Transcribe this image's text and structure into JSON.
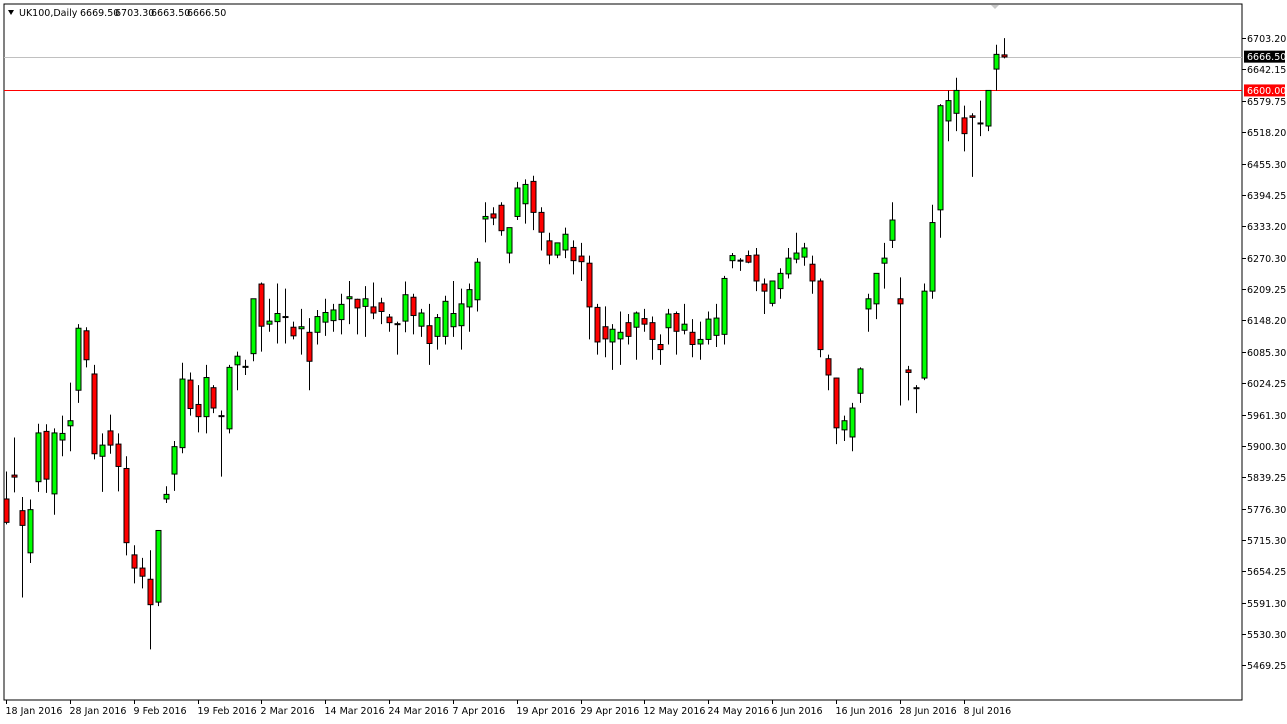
{
  "header": {
    "symbol": "UK100,Daily",
    "open": "6669.50",
    "high": "6703.30",
    "low": "6663.50",
    "close": "6666.50"
  },
  "chart_data": {
    "type": "candlestick",
    "symbol": "UK100",
    "timeframe": "Daily",
    "x_labels": [
      "18 Jan 2016",
      "28 Jan 2016",
      "9 Feb 2016",
      "19 Feb 2016",
      "2 Mar 2016",
      "14 Mar 2016",
      "24 Mar 2016",
      "7 Apr 2016",
      "19 Apr 2016",
      "29 Apr 2016",
      "12 May 2016",
      "24 May 2016",
      "6 Jun 2016",
      "16 Jun 2016",
      "28 Jun 2016",
      "8 Jul 2016"
    ],
    "y_ticks": [
      "6703.20",
      "6642.15",
      "6579.75",
      "6518.20",
      "6455.30",
      "6394.25",
      "6333.20",
      "6270.30",
      "6209.25",
      "6148.20",
      "6085.30",
      "6024.25",
      "5961.30",
      "5900.30",
      "5839.25",
      "5776.30",
      "5715.30",
      "5654.25",
      "5591.30",
      "5530.30",
      "5469.25"
    ],
    "ylim": [
      5458,
      6730
    ],
    "current_price": {
      "value": 6666.5,
      "label": "6666.50"
    },
    "levels": [
      {
        "value": 6600.0,
        "label": "6600.00",
        "color": "#ff0000"
      }
    ],
    "colors": {
      "bull": "#00ff00",
      "bear": "#ff0000",
      "outline": "#000000",
      "axis": "#000000",
      "current_line": "#c0c0c0"
    },
    "candles": [
      {
        "o": 5796,
        "h": 5850,
        "l": 5746,
        "c": 5750
      },
      {
        "o": 5843,
        "h": 5917,
        "l": 5809,
        "c": 5839
      },
      {
        "o": 5773,
        "h": 5800,
        "l": 5602,
        "c": 5744
      },
      {
        "o": 5690,
        "h": 5795,
        "l": 5670,
        "c": 5775
      },
      {
        "o": 5830,
        "h": 5944,
        "l": 5810,
        "c": 5926
      },
      {
        "o": 5929,
        "h": 5943,
        "l": 5808,
        "c": 5835
      },
      {
        "o": 5806,
        "h": 5935,
        "l": 5765,
        "c": 5926
      },
      {
        "o": 5912,
        "h": 5960,
        "l": 5880,
        "c": 5925
      },
      {
        "o": 5940,
        "h": 6025,
        "l": 5890,
        "c": 5950
      },
      {
        "o": 6010,
        "h": 6140,
        "l": 5985,
        "c": 6132
      },
      {
        "o": 6127,
        "h": 6134,
        "l": 6055,
        "c": 6070
      },
      {
        "o": 6042,
        "h": 6060,
        "l": 5874,
        "c": 5885
      },
      {
        "o": 5880,
        "h": 5925,
        "l": 5810,
        "c": 5902
      },
      {
        "o": 5930,
        "h": 5962,
        "l": 5885,
        "c": 5902
      },
      {
        "o": 5904,
        "h": 5925,
        "l": 5811,
        "c": 5860
      },
      {
        "o": 5856,
        "h": 5880,
        "l": 5685,
        "c": 5710
      },
      {
        "o": 5686,
        "h": 5705,
        "l": 5630,
        "c": 5660
      },
      {
        "o": 5660,
        "h": 5680,
        "l": 5620,
        "c": 5644
      },
      {
        "o": 5638,
        "h": 5695,
        "l": 5500,
        "c": 5588
      },
      {
        "o": 5593,
        "h": 5735,
        "l": 5585,
        "c": 5734
      },
      {
        "o": 5796,
        "h": 5821,
        "l": 5788,
        "c": 5805
      },
      {
        "o": 5845,
        "h": 5910,
        "l": 5812,
        "c": 5899
      },
      {
        "o": 5897,
        "h": 6064,
        "l": 5886,
        "c": 6032
      },
      {
        "o": 6030,
        "h": 6045,
        "l": 5960,
        "c": 5974
      },
      {
        "o": 5982,
        "h": 6020,
        "l": 5927,
        "c": 5958
      },
      {
        "o": 5958,
        "h": 6060,
        "l": 5925,
        "c": 6035
      },
      {
        "o": 6015,
        "h": 6020,
        "l": 5965,
        "c": 5975
      },
      {
        "o": 5959,
        "h": 5970,
        "l": 5840,
        "c": 5960
      },
      {
        "o": 5934,
        "h": 6060,
        "l": 5925,
        "c": 6055
      },
      {
        "o": 6060,
        "h": 6086,
        "l": 6010,
        "c": 6077
      },
      {
        "o": 6055,
        "h": 6070,
        "l": 6040,
        "c": 6057
      },
      {
        "o": 6082,
        "h": 6140,
        "l": 6067,
        "c": 6190
      },
      {
        "o": 6219,
        "h": 6222,
        "l": 6086,
        "c": 6136
      },
      {
        "o": 6140,
        "h": 6190,
        "l": 6125,
        "c": 6146
      },
      {
        "o": 6145,
        "h": 6220,
        "l": 6102,
        "c": 6161
      },
      {
        "o": 6154,
        "h": 6210,
        "l": 6102,
        "c": 6155
      },
      {
        "o": 6134,
        "h": 6145,
        "l": 6110,
        "c": 6117
      },
      {
        "o": 6131,
        "h": 6170,
        "l": 6080,
        "c": 6135
      },
      {
        "o": 6124,
        "h": 6152,
        "l": 6010,
        "c": 6067
      },
      {
        "o": 6124,
        "h": 6168,
        "l": 6100,
        "c": 6155
      },
      {
        "o": 6144,
        "h": 6190,
        "l": 6117,
        "c": 6163
      },
      {
        "o": 6147,
        "h": 6180,
        "l": 6125,
        "c": 6168
      },
      {
        "o": 6149,
        "h": 6200,
        "l": 6120,
        "c": 6179
      },
      {
        "o": 6190,
        "h": 6225,
        "l": 6140,
        "c": 6194
      },
      {
        "o": 6189,
        "h": 6190,
        "l": 6120,
        "c": 6172
      },
      {
        "o": 6175,
        "h": 6215,
        "l": 6115,
        "c": 6190
      },
      {
        "o": 6174,
        "h": 6222,
        "l": 6150,
        "c": 6162
      },
      {
        "o": 6182,
        "h": 6192,
        "l": 6140,
        "c": 6165
      },
      {
        "o": 6154,
        "h": 6160,
        "l": 6125,
        "c": 6143
      },
      {
        "o": 6141,
        "h": 6145,
        "l": 6080,
        "c": 6140
      },
      {
        "o": 6146,
        "h": 6224,
        "l": 6124,
        "c": 6198
      },
      {
        "o": 6193,
        "h": 6200,
        "l": 6120,
        "c": 6157
      },
      {
        "o": 6136,
        "h": 6170,
        "l": 6115,
        "c": 6162
      },
      {
        "o": 6137,
        "h": 6180,
        "l": 6060,
        "c": 6102
      },
      {
        "o": 6116,
        "h": 6160,
        "l": 6090,
        "c": 6153
      },
      {
        "o": 6116,
        "h": 6196,
        "l": 6100,
        "c": 6185
      },
      {
        "o": 6135,
        "h": 6225,
        "l": 6115,
        "c": 6161
      },
      {
        "o": 6137,
        "h": 6210,
        "l": 6090,
        "c": 6180
      },
      {
        "o": 6174,
        "h": 6220,
        "l": 6125,
        "c": 6208
      },
      {
        "o": 6188,
        "h": 6270,
        "l": 6165,
        "c": 6262
      },
      {
        "o": 6347,
        "h": 6380,
        "l": 6301,
        "c": 6352
      },
      {
        "o": 6357,
        "h": 6370,
        "l": 6335,
        "c": 6349
      },
      {
        "o": 6374,
        "h": 6380,
        "l": 6314,
        "c": 6324
      },
      {
        "o": 6280,
        "h": 6310,
        "l": 6260,
        "c": 6330
      },
      {
        "o": 6352,
        "h": 6420,
        "l": 6345,
        "c": 6408
      },
      {
        "o": 6377,
        "h": 6425,
        "l": 6338,
        "c": 6415
      },
      {
        "o": 6421,
        "h": 6432,
        "l": 6325,
        "c": 6360
      },
      {
        "o": 6360,
        "h": 6370,
        "l": 6285,
        "c": 6321
      },
      {
        "o": 6304,
        "h": 6320,
        "l": 6258,
        "c": 6276
      },
      {
        "o": 6276,
        "h": 6300,
        "l": 6270,
        "c": 6300
      },
      {
        "o": 6286,
        "h": 6330,
        "l": 6270,
        "c": 6317
      },
      {
        "o": 6291,
        "h": 6305,
        "l": 6238,
        "c": 6265
      },
      {
        "o": 6274,
        "h": 6300,
        "l": 6225,
        "c": 6263
      },
      {
        "o": 6260,
        "h": 6275,
        "l": 6110,
        "c": 6174
      },
      {
        "o": 6173,
        "h": 6180,
        "l": 6080,
        "c": 6105
      },
      {
        "o": 6135,
        "h": 6175,
        "l": 6075,
        "c": 6111
      },
      {
        "o": 6105,
        "h": 6140,
        "l": 6050,
        "c": 6130
      },
      {
        "o": 6111,
        "h": 6165,
        "l": 6060,
        "c": 6124
      },
      {
        "o": 6143,
        "h": 6160,
        "l": 6100,
        "c": 6116
      },
      {
        "o": 6134,
        "h": 6165,
        "l": 6070,
        "c": 6162
      },
      {
        "o": 6151,
        "h": 6170,
        "l": 6125,
        "c": 6140
      },
      {
        "o": 6143,
        "h": 6155,
        "l": 6070,
        "c": 6110
      },
      {
        "o": 6100,
        "h": 6120,
        "l": 6060,
        "c": 6090
      },
      {
        "o": 6133,
        "h": 6170,
        "l": 6100,
        "c": 6160
      },
      {
        "o": 6161,
        "h": 6165,
        "l": 6080,
        "c": 6126
      },
      {
        "o": 6128,
        "h": 6180,
        "l": 6120,
        "c": 6140
      },
      {
        "o": 6124,
        "h": 6150,
        "l": 6075,
        "c": 6100
      },
      {
        "o": 6101,
        "h": 6145,
        "l": 6070,
        "c": 6110
      },
      {
        "o": 6110,
        "h": 6165,
        "l": 6100,
        "c": 6150
      },
      {
        "o": 6118,
        "h": 6180,
        "l": 6095,
        "c": 6152
      },
      {
        "o": 6120,
        "h": 6235,
        "l": 6100,
        "c": 6230
      },
      {
        "o": 6265,
        "h": 6280,
        "l": 6250,
        "c": 6275
      },
      {
        "o": 6266,
        "h": 6270,
        "l": 6245,
        "c": 6265
      },
      {
        "o": 6275,
        "h": 6285,
        "l": 6260,
        "c": 6262
      },
      {
        "o": 6276,
        "h": 6290,
        "l": 6205,
        "c": 6225
      },
      {
        "o": 6219,
        "h": 6230,
        "l": 6160,
        "c": 6205
      },
      {
        "o": 6181,
        "h": 6222,
        "l": 6175,
        "c": 6225
      },
      {
        "o": 6210,
        "h": 6250,
        "l": 6190,
        "c": 6240
      },
      {
        "o": 6239,
        "h": 6290,
        "l": 6230,
        "c": 6270
      },
      {
        "o": 6268,
        "h": 6320,
        "l": 6260,
        "c": 6280
      },
      {
        "o": 6272,
        "h": 6300,
        "l": 6255,
        "c": 6290
      },
      {
        "o": 6258,
        "h": 6275,
        "l": 6200,
        "c": 6225
      },
      {
        "o": 6225,
        "h": 6230,
        "l": 6075,
        "c": 6090
      },
      {
        "o": 6072,
        "h": 6080,
        "l": 6010,
        "c": 6040
      },
      {
        "o": 6034,
        "h": 6035,
        "l": 5904,
        "c": 5936
      },
      {
        "o": 5932,
        "h": 5960,
        "l": 5910,
        "c": 5950
      },
      {
        "o": 5918,
        "h": 5985,
        "l": 5890,
        "c": 5975
      },
      {
        "o": 6004,
        "h": 6055,
        "l": 5985,
        "c": 6052
      },
      {
        "o": 6170,
        "h": 6200,
        "l": 6125,
        "c": 6190
      },
      {
        "o": 6180,
        "h": 6240,
        "l": 6150,
        "c": 6240
      },
      {
        "o": 6260,
        "h": 6300,
        "l": 6210,
        "c": 6270
      },
      {
        "o": 6305,
        "h": 6380,
        "l": 6290,
        "c": 6345
      },
      {
        "o": 6190,
        "h": 6232,
        "l": 5980,
        "c": 6180
      },
      {
        "o": 6050,
        "h": 6058,
        "l": 5990,
        "c": 6045
      },
      {
        "o": 6015,
        "h": 6020,
        "l": 5965,
        "c": 6015
      },
      {
        "o": 6034,
        "h": 6220,
        "l": 6030,
        "c": 6205
      },
      {
        "o": 6205,
        "h": 6375,
        "l": 6190,
        "c": 6340
      },
      {
        "o": 6365,
        "h": 6573,
        "l": 6310,
        "c": 6570
      },
      {
        "o": 6540,
        "h": 6600,
        "l": 6500,
        "c": 6580
      },
      {
        "o": 6555,
        "h": 6625,
        "l": 6520,
        "c": 6600
      },
      {
        "o": 6546,
        "h": 6570,
        "l": 6480,
        "c": 6515
      },
      {
        "o": 6550,
        "h": 6555,
        "l": 6430,
        "c": 6547
      },
      {
        "o": 6535,
        "h": 6580,
        "l": 6510,
        "c": 6536
      },
      {
        "o": 6530,
        "h": 6600,
        "l": 6520,
        "c": 6600
      },
      {
        "o": 6642,
        "h": 6690,
        "l": 6600,
        "c": 6671
      },
      {
        "o": 6670,
        "h": 6703,
        "l": 6663,
        "c": 6666
      }
    ]
  }
}
